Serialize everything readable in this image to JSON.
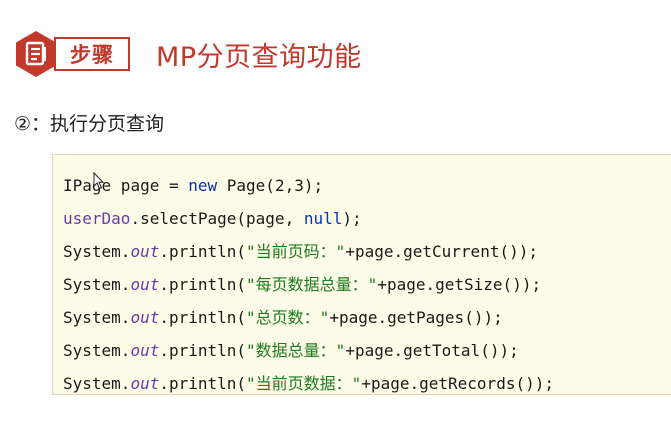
{
  "header": {
    "step_label": "步骤",
    "title": "MP分页查询功能",
    "icon": "document-icon",
    "accent_color": "#c1392b"
  },
  "subtitle": "②：执行分页查询",
  "code": {
    "line1": {
      "type": "IPage",
      "decl": " page = ",
      "kw_new": "new",
      "rest": " Page(2,3);"
    },
    "line2": {
      "obj": "userDao",
      "call": ".selectPage(page, ",
      "kw_null": "null",
      "end": ");"
    },
    "line3": {
      "sys": "System.",
      "out": "out",
      "println": ".println(",
      "str": "\"当前页码：\"",
      "rest": "+page.getCurrent());"
    },
    "line4": {
      "sys": "System.",
      "out": "out",
      "println": ".println(",
      "str": "\"每页数据总量：\"",
      "rest": "+page.getSize());"
    },
    "line5": {
      "sys": "System.",
      "out": "out",
      "println": ".println(",
      "str": "\"总页数：\"",
      "rest": "+page.getPages());"
    },
    "line6": {
      "sys": "System.",
      "out": "out",
      "println": ".println(",
      "str": "\"数据总量：\"",
      "rest": "+page.getTotal());"
    },
    "line7": {
      "sys": "System.",
      "out": "out",
      "println": ".println(",
      "str": "\"当前页数据：\"",
      "rest": "+page.getRecords());"
    }
  }
}
